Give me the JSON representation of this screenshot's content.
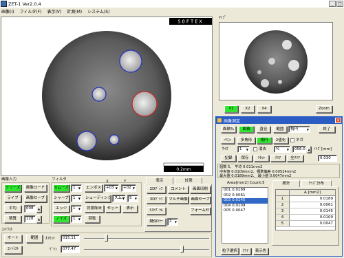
{
  "app": {
    "title": "ZET-1 Ver2.0.4"
  },
  "menu": [
    "画像(I)",
    "フィルタ(F)",
    "表示(V)",
    "計測(M)",
    "システム(S)"
  ],
  "image": {
    "watermark": "SOFTEX",
    "scalebar": "0.2mm"
  },
  "map_panel": {
    "title": "ﾏｯﾌﾟ",
    "zoom_buttons": [
      "X1",
      "X2",
      "X4"
    ],
    "zoom_label": "Zoom"
  },
  "image_input": {
    "title": "画像入力",
    "live": "ライブ",
    "freeze": "フリーズ",
    "image_load": "画像ロード",
    "image_save": "画像セーブ",
    "average": "平均",
    "average_value": "008",
    "accumulate": "積算",
    "accumulate_value": "128"
  },
  "filter": {
    "title": "フィルタ",
    "smooth": "スムーズ",
    "smooth_val": "1",
    "sharp": "シャープ",
    "sharp_val": "1",
    "edge": "エッジ",
    "edge_val": "1",
    "noise": "ノイズ",
    "noise_val": "1",
    "emboss": "エンボス",
    "x_label": "X",
    "y_label": "Y",
    "x_val": "+03",
    "y_val": "+02",
    "shading": "シェーディング",
    "shading_mode": "スムーズ",
    "shading_val": "5",
    "bg_remove": "背景除去",
    "set": "セット",
    "display": "表示",
    "rotate": "回転"
  },
  "display_tabs": {
    "display": "表示",
    "measure": "計測"
  },
  "display_panel": {
    "b2d": "2Dｸﾞﾗﾌ",
    "b3d": "3Dｸﾞﾗﾌ",
    "histogram": "ﾋｽﾄｸﾞﾗﾑ",
    "pseudo_color": "疑似ｶﾗｰ",
    "pseudo_val": "2",
    "comment": "コメント",
    "image_print": "画面印刷",
    "multi_image": "マルチ画像",
    "screen_save": "画面セーブ",
    "form_save": "フォームセーブ"
  },
  "contrast": {
    "title": "ｺﾝﾄﾗｽﾄ",
    "auto": "オート",
    "range": "範囲",
    "contrast_btn": "ｺﾝﾄﾗｽﾄ",
    "offset_label": "ｵﾌｾｯﾄ",
    "offset_val": "015.11",
    "gain_label": "ｹﾞｲﾝ",
    "gain_val": "077.47"
  },
  "measure_dialog": {
    "title": "画像測定",
    "row1": [
      "面積%",
      "面積",
      "直径",
      "範囲",
      "楕円",
      "終了"
    ],
    "row2": [
      "ペン",
      "多角形",
      "楕円",
      "2値化",
      "ネガ"
    ],
    "size_label": "ｻｲｽﾞ",
    "size_val": "1",
    "erase": "消去",
    "pct": "%",
    "threshold": "056.0",
    "noise_label": "ﾉｲｽﾞ[mm]",
    "row3": [
      "記録",
      "保存",
      "ﾘｾｯﾄ",
      "ｸﾘｱ",
      "全ｸﾘｱ"
    ],
    "noise_val": "0.030",
    "stats": [
      "個数 5、 平均 0.011mm2",
      "中央値 0.0109mm2、標準偏差 0.00524mm2",
      "最大値 0.0189mm2、 最小値 0.0047mm2"
    ],
    "area_header": "Area[mm2] Count:5",
    "area_list": [
      "001 0.0189",
      "002 0.0061",
      "003 0.0145",
      "004 0.0109",
      "005 0.0047"
    ],
    "stat_tabs": {
      "stats": "統計",
      "size_dist": "ｻｲｽﾞ分布"
    },
    "table_header": "A [mm2]",
    "table_rows": [
      {
        "n": "1",
        "v": "0.0189"
      },
      {
        "n": "2",
        "v": "0.0061"
      },
      {
        "n": "3",
        "v": "0.0145"
      },
      {
        "n": "4",
        "v": "0.0109"
      },
      {
        "n": "5",
        "v": "0.0047"
      }
    ],
    "bottom": [
      "粒子選択",
      "ｸﾘｱ",
      "表示色"
    ]
  },
  "colors": {
    "green": "#2ee62e",
    "circle_blue": "#2030c0",
    "circle_red": "#d02020",
    "dialog_title": "#2a5cc4"
  }
}
